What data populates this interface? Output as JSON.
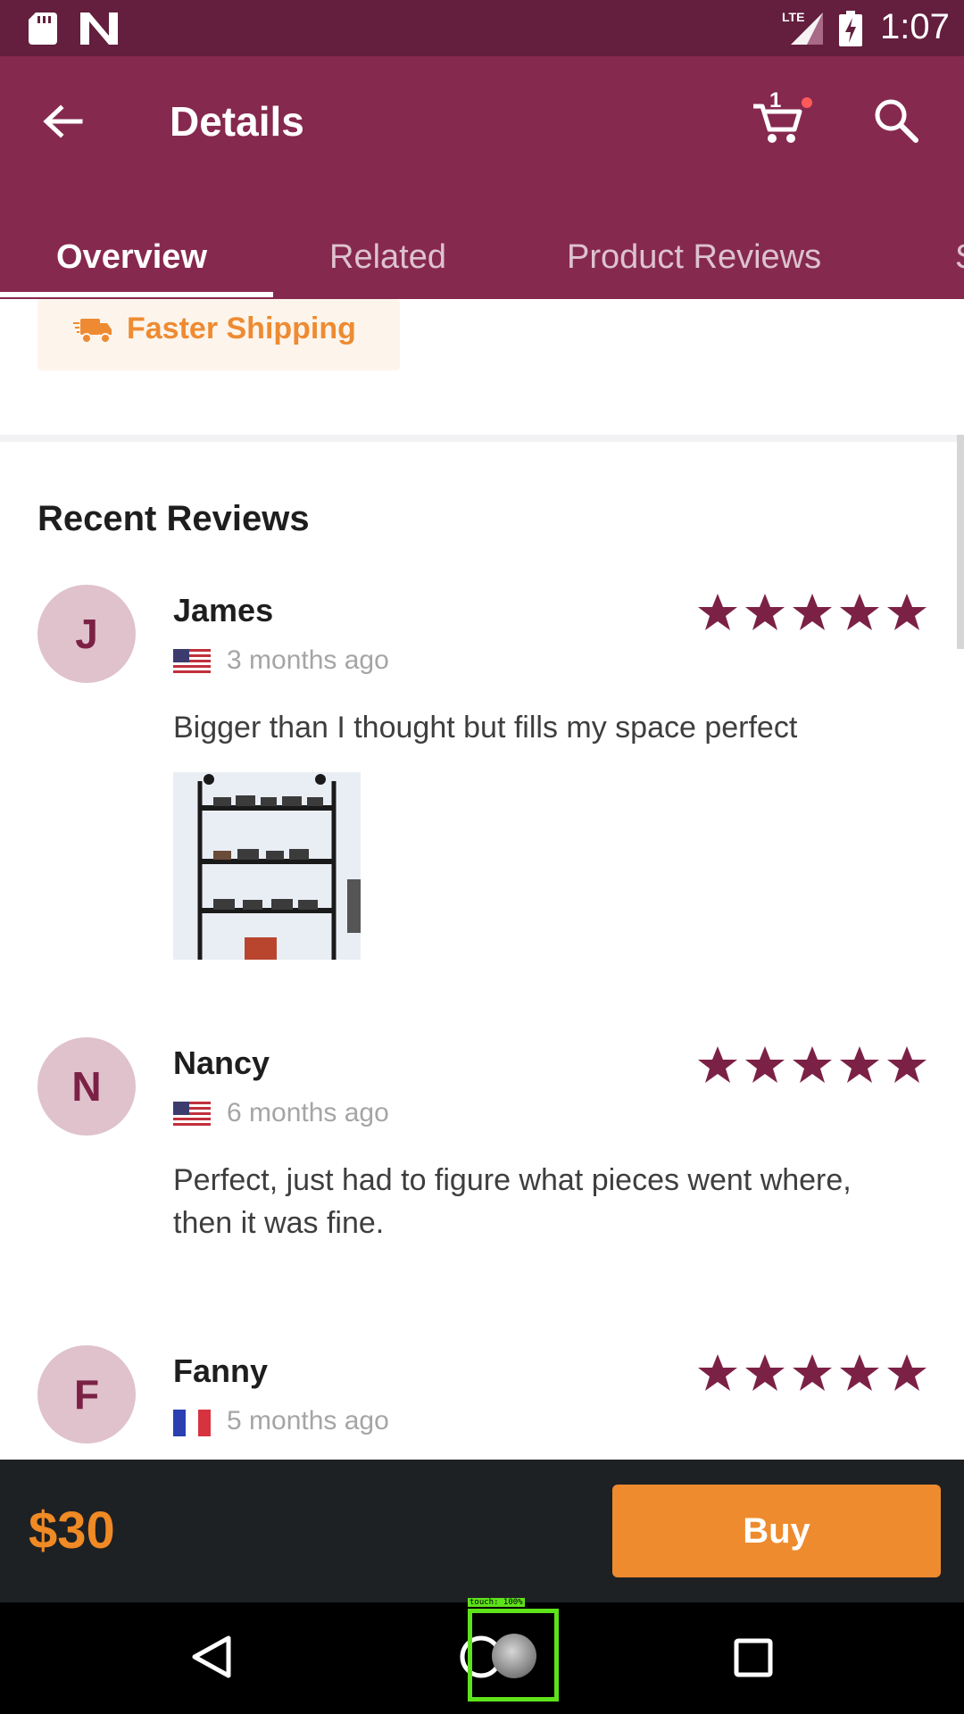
{
  "status_bar": {
    "time": "1:07",
    "network": "LTE"
  },
  "app_bar": {
    "title": "Details",
    "cart_count": "1",
    "tabs": [
      {
        "label": "Overview",
        "active": true
      },
      {
        "label": "Related",
        "active": false
      },
      {
        "label": "Product Reviews",
        "active": false
      },
      {
        "label": "S",
        "active": false
      }
    ]
  },
  "shipping": {
    "label": "Faster Shipping"
  },
  "reviews_section": {
    "title": "Recent Reviews",
    "reviews": [
      {
        "initial": "J",
        "name": "James",
        "country_flag": "us-flag",
        "time": "3 months ago",
        "rating": 5,
        "text": "Bigger than I thought but fills my space perfect",
        "has_photo": true
      },
      {
        "initial": "N",
        "name": "Nancy",
        "country_flag": "us-flag",
        "time": "6 months ago",
        "rating": 5,
        "text": "Perfect, just had to figure what pieces went where, then it was fine.",
        "has_photo": false
      },
      {
        "initial": "F",
        "name": "Fanny",
        "country_flag": "fr-flag",
        "time": "5 months ago",
        "rating": 5,
        "text": "",
        "has_photo": false
      }
    ]
  },
  "buy_bar": {
    "price": "$30",
    "buy_label": "Buy"
  },
  "overlay": {
    "touch_label": "touch: 100%"
  },
  "colors": {
    "status_bar": "#631f3d",
    "app_bar": "#86294f",
    "star": "#7c2146",
    "accent_orange": "#ee8b2e",
    "buy_bar": "#1e2124"
  }
}
